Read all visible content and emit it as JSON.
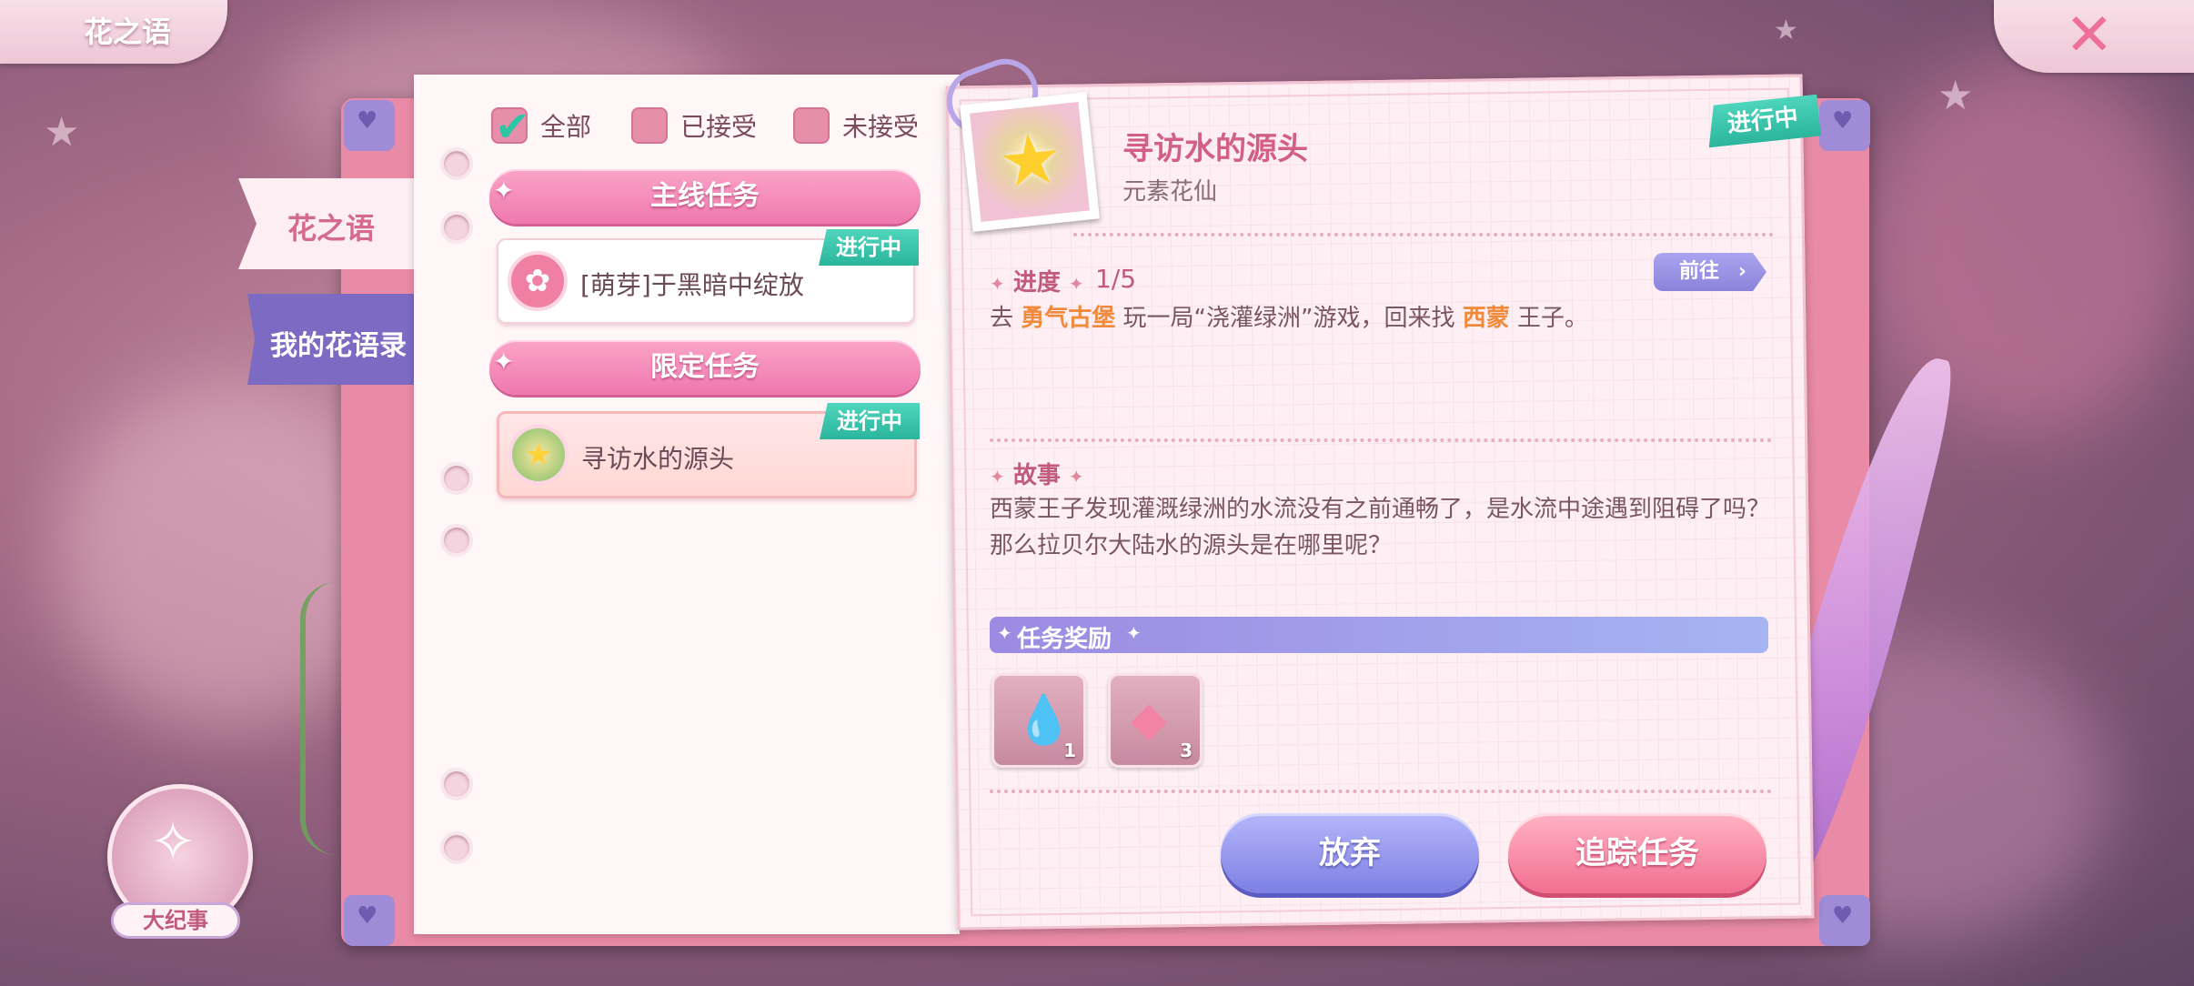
{
  "header": {
    "title": "花之语",
    "close_icon": "close-x-icon"
  },
  "side_tabs": {
    "flower_words": "花之语",
    "my_records": "我的花语录"
  },
  "filters": [
    {
      "label": "全部",
      "checked": true
    },
    {
      "label": "已接受",
      "checked": false
    },
    {
      "label": "未接受",
      "checked": false
    }
  ],
  "categories": {
    "main": "主线任务",
    "limited": "限定任务"
  },
  "quests": [
    {
      "name": "[萌芽]于黑暗中绽放",
      "status": "进行中",
      "icon": "flower-icon"
    },
    {
      "name": "寻访水的源头",
      "status": "进行中",
      "icon": "star-clover-icon",
      "selected": true
    }
  ],
  "detail": {
    "title": "寻访水的源头",
    "subtitle": "元素花仙",
    "status": "进行中",
    "progress_label": "进度",
    "progress_value": "1/5",
    "goto_label": "前往",
    "desc_pre": "去 ",
    "desc_place": "勇气古堡",
    "desc_mid": " 玩一局“浇灌绿洲”游戏，回来找 ",
    "desc_person": "西蒙",
    "desc_post": " 王子。",
    "story_label": "故事",
    "story": "西蒙王子发现灌溉绿洲的水流没有之前通畅了，是水流中途遇到阻碍了吗？那么拉贝尔大陆水的源头是在哪里呢？",
    "reward_label": "任务奖励",
    "rewards": [
      {
        "icon": "seed-drop-icon",
        "qty": "1"
      },
      {
        "icon": "crystal-gem-icon",
        "qty": "3"
      }
    ]
  },
  "buttons": {
    "abandon": "放弃",
    "track": "追踪任务"
  },
  "chronicle": {
    "label": "大纪事"
  },
  "colors": {
    "accent_pink": "#ef78ad",
    "status_teal": "#2ab59c",
    "abandon": "#7d7fe3",
    "track": "#f26f8f",
    "highlight": "#f08a3c"
  }
}
